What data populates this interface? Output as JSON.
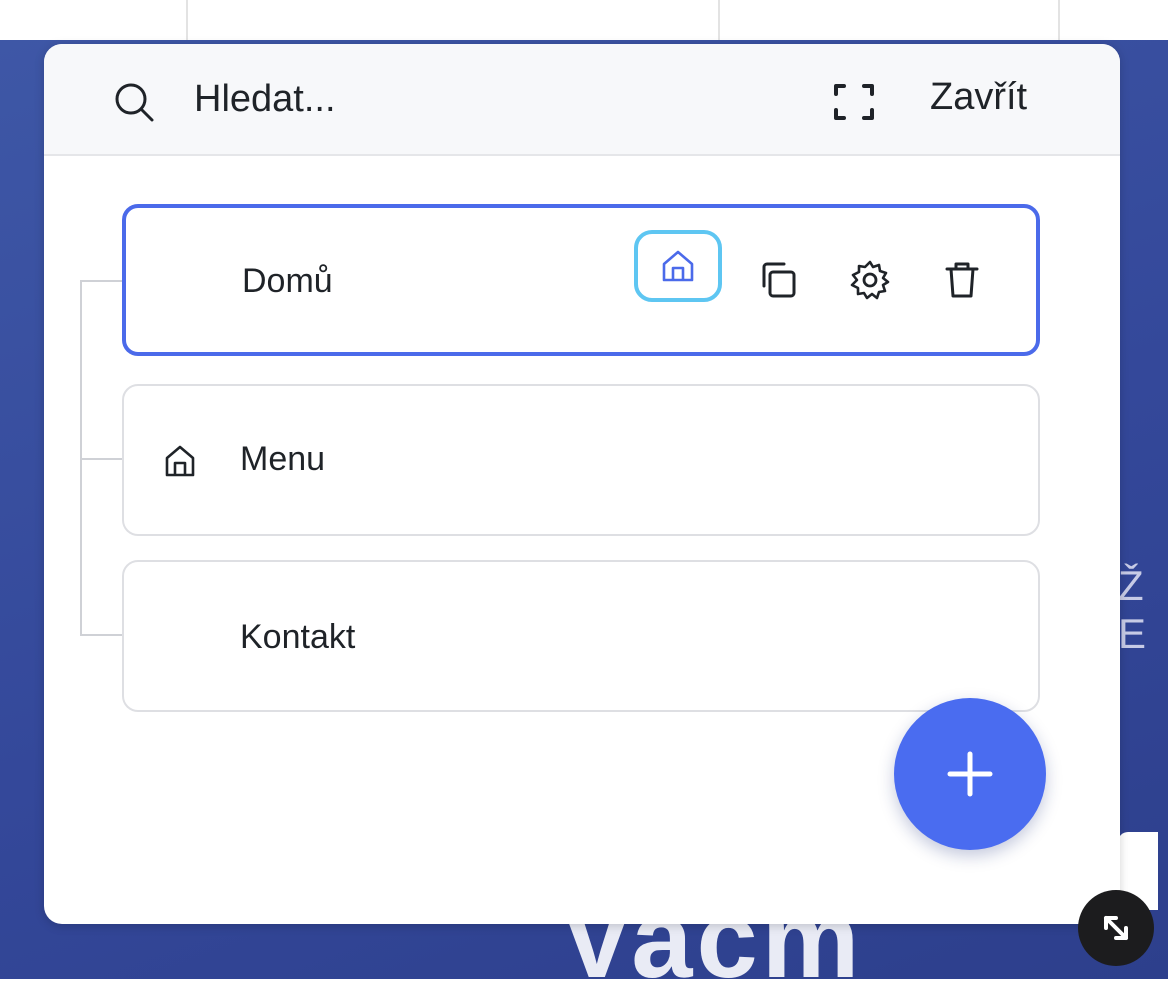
{
  "search": {
    "placeholder": "Hledat..."
  },
  "header": {
    "close_label": "Zavřít"
  },
  "pages": [
    {
      "label": "Domů",
      "selected": true,
      "is_home": false
    },
    {
      "label": "Menu",
      "selected": false,
      "is_home": true
    },
    {
      "label": "Kontakt",
      "selected": false,
      "is_home": false
    }
  ],
  "background": {
    "letter": "Ž E",
    "big_text": "Vacm"
  },
  "icons": {
    "search": "search-icon",
    "fullscreen": "fullscreen-icon",
    "set_home": "home-icon",
    "duplicate": "duplicate-icon",
    "settings": "gear-icon",
    "delete": "trash-icon",
    "add": "plus-icon",
    "resize": "resize-icon"
  },
  "colors": {
    "accent": "#4a6cf0",
    "selected_border": "#4b6aea",
    "home_highlight": "#5ec6f2",
    "background_blue": "#3a52a0"
  }
}
